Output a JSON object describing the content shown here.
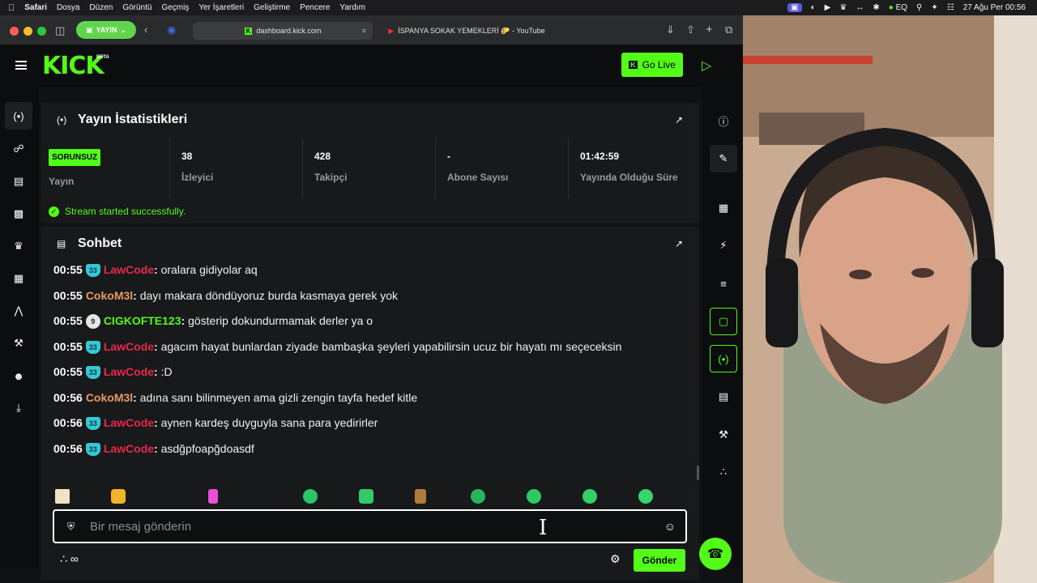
{
  "menubar": {
    "app": "Safari",
    "items": [
      "Dosya",
      "Düzen",
      "Görüntü",
      "Geçmiş",
      "Yer İşaretleri",
      "Geliştirme",
      "Pencere",
      "Yardım"
    ],
    "eq": "EQ",
    "datetime": "27 Ağu Per  00:56"
  },
  "browser": {
    "tab_group": "YAYIN",
    "tab1": "dashboard.kick.com",
    "tab2": "İSPANYA SOKAK YEMEKLERİ 🌮 - YouTube"
  },
  "kick": {
    "logo": "KICK",
    "beta": "BETA",
    "go_live": "Go Live"
  },
  "stats": {
    "title": "Yayın İstatistikleri",
    "status_badge": "SORUNSUZ",
    "status_label": "Yayın",
    "viewers_value": "38",
    "viewers_label": "İzleyici",
    "followers_value": "428",
    "followers_label": "Takipçi",
    "subs_value": "-",
    "subs_label": "Abone Sayısı",
    "uptime_value": "01:42:59",
    "uptime_label": "Yayında Olduğu Süre",
    "message": "Stream started successfully."
  },
  "chat": {
    "title": "Sohbet",
    "messages": [
      {
        "time": "00:55",
        "badge": "33",
        "badge_type": "sub",
        "user": "LawCode",
        "color": "#e8284a",
        "text": "oralara gidiyolar aq"
      },
      {
        "time": "00:55",
        "badge": "",
        "badge_type": "none",
        "user": "CokoM3l",
        "color": "#e79b62",
        "text": "dayı makara döndüyoruz burda kasmaya gerek yok"
      },
      {
        "time": "00:55",
        "badge": "9",
        "badge_type": "level",
        "user": "CIGKOFTE123",
        "color": "#53fc18",
        "text": "gösterip dokundurmamak derler ya o"
      },
      {
        "time": "00:55",
        "badge": "33",
        "badge_type": "sub",
        "user": "LawCode",
        "color": "#e8284a",
        "text": "agacım hayat bunlardan ziyade bambaşka şeyleri yapabilirsin ucuz bir hayatı mı seçeceksin"
      },
      {
        "time": "00:55",
        "badge": "33",
        "badge_type": "sub",
        "user": "LawCode",
        "color": "#e8284a",
        "text": ":D"
      },
      {
        "time": "00:56",
        "badge": "",
        "badge_type": "none",
        "user": "CokoM3l",
        "color": "#e79b62",
        "text": "adına sanı bilinmeyen ama gizli zengin tayfa hedef kitle"
      },
      {
        "time": "00:56",
        "badge": "33",
        "badge_type": "sub",
        "user": "LawCode",
        "color": "#e8284a",
        "text": "aynen kardeş duyguyla sana para yedirirler"
      },
      {
        "time": "00:56",
        "badge": "33",
        "badge_type": "sub",
        "user": "LawCode",
        "color": "#e8284a",
        "text": "asdğpfoapğdoasdf"
      }
    ],
    "input_placeholder": "Bir mesaj gönderin",
    "send_label": "Gönder",
    "infinity": "∞"
  },
  "colors": {
    "accent": "#53fc18",
    "panel": "#18191b",
    "background": "#0c0d0e"
  }
}
